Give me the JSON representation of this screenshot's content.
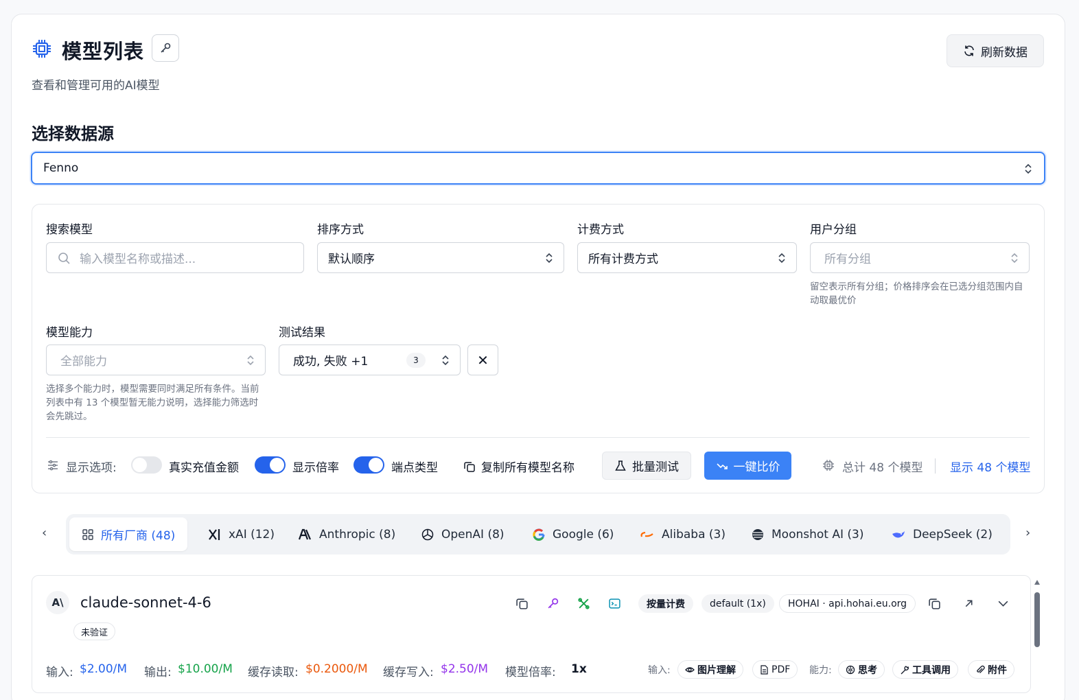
{
  "header": {
    "title": "模型列表",
    "subtitle": "查看和管理可用的AI模型",
    "refresh_label": "刷新数据"
  },
  "source": {
    "section_title": "选择数据源",
    "selected": "Fenno"
  },
  "filters": {
    "search": {
      "label": "搜索模型",
      "placeholder": "输入模型名称或描述..."
    },
    "sort": {
      "label": "排序方式",
      "value": "默认顺序"
    },
    "billing": {
      "label": "计费方式",
      "value": "所有计费方式"
    },
    "group": {
      "label": "用户分组",
      "placeholder": "所有分组",
      "hint": "留空表示所有分组；价格排序会在已选分组范围内自动取最优价"
    },
    "capability": {
      "label": "模型能力",
      "placeholder": "全部能力",
      "hint": "选择多个能力时，模型需要同时满足所有条件。当前列表中有 13 个模型暂无能力说明，选择能力筛选时会先跳过。"
    },
    "test_result": {
      "label": "测试结果",
      "value": "成功, 失败 +1",
      "count": "3"
    },
    "clear_label": "✕"
  },
  "options": {
    "label": "显示选项:",
    "real_amount": {
      "label": "真实充值金额",
      "on": false
    },
    "show_ratio": {
      "label": "显示倍率",
      "on": true
    },
    "endpoint_type": {
      "label": "端点类型",
      "on": true
    },
    "copy_all": "复制所有模型名称",
    "batch_test": "批量测试",
    "compare": "一键比价",
    "total": "总计 48 个模型",
    "showing": "显示 48 个模型"
  },
  "vendors": [
    {
      "label": "所有厂商 (48)",
      "icon": "grid-icon",
      "active": true
    },
    {
      "label": "xAI (12)",
      "icon": "xai-icon"
    },
    {
      "label": "Anthropic (8)",
      "icon": "anthropic-icon"
    },
    {
      "label": "OpenAI (8)",
      "icon": "openai-icon"
    },
    {
      "label": "Google (6)",
      "icon": "google-icon"
    },
    {
      "label": "Alibaba (3)",
      "icon": "alibaba-icon"
    },
    {
      "label": "Moonshot AI (3)",
      "icon": "moonshot-icon"
    },
    {
      "label": "DeepSeek (2)",
      "icon": "deepseek-icon"
    }
  ],
  "model": {
    "avatar": "A\\",
    "name": "claude-sonnet-4-6",
    "status": "未验证",
    "billing_tag": "按量计费",
    "group_tag": "default (1x)",
    "endpoint_tag": "HOHAI · api.hohai.eu.org",
    "prices": {
      "input_label": "输入:",
      "input": "$2.00/M",
      "output_label": "输出:",
      "output": "$10.00/M",
      "cache_read_label": "缓存读取:",
      "cache_read": "$0.2000/M",
      "cache_write_label": "缓存写入:",
      "cache_write": "$2.50/M",
      "ratio_label": "模型倍率:",
      "ratio": "1x"
    },
    "input_label": "输入:",
    "inputs": [
      "图片理解",
      "PDF"
    ],
    "capabilities_label": "能力:",
    "capabilities": [
      "思考",
      "工具调用",
      "附件"
    ]
  },
  "colors": {
    "accent": "#3b82f6",
    "input_price": "#2563eb",
    "output_price": "#16a34a",
    "cache_read_price": "#ea580c",
    "cache_write_price": "#9333ea"
  }
}
